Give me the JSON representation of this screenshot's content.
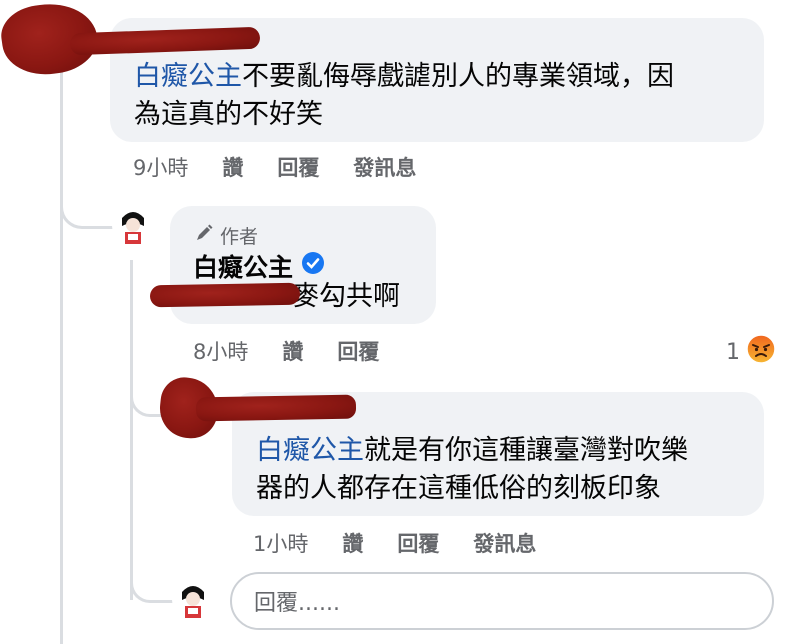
{
  "comment1": {
    "mention": "白癡公主",
    "text_line1": "不要亂侮辱戲謔別人的專業領域，因",
    "text_line2": "為這真的不好笑",
    "time": "9小時",
    "like": "讚",
    "reply": "回覆",
    "message": "發訊息"
  },
  "reply1": {
    "author_badge": "作者",
    "author_name": "白癡公主",
    "text_suffix": "麥勾共啊",
    "time": "8小時",
    "like": "讚",
    "reply": "回覆",
    "reaction_count": "1",
    "reaction_icon": "angry-face",
    "verified_color": "#1877f2"
  },
  "reply2": {
    "mention": "白癡公主",
    "text_line1": "就是有你這種讓臺灣對吹樂",
    "text_line2": "器的人都存在這種低俗的刻板印象",
    "time": "1小時",
    "like": "讚",
    "reply": "回覆",
    "message": "發訊息"
  },
  "composer": {
    "placeholder": "回覆......"
  },
  "colors": {
    "bubble": "#f0f2f5",
    "mention": "#1f57a8",
    "meta": "#65676b",
    "redaction": "#8a1712",
    "angry": "#f0651e"
  }
}
